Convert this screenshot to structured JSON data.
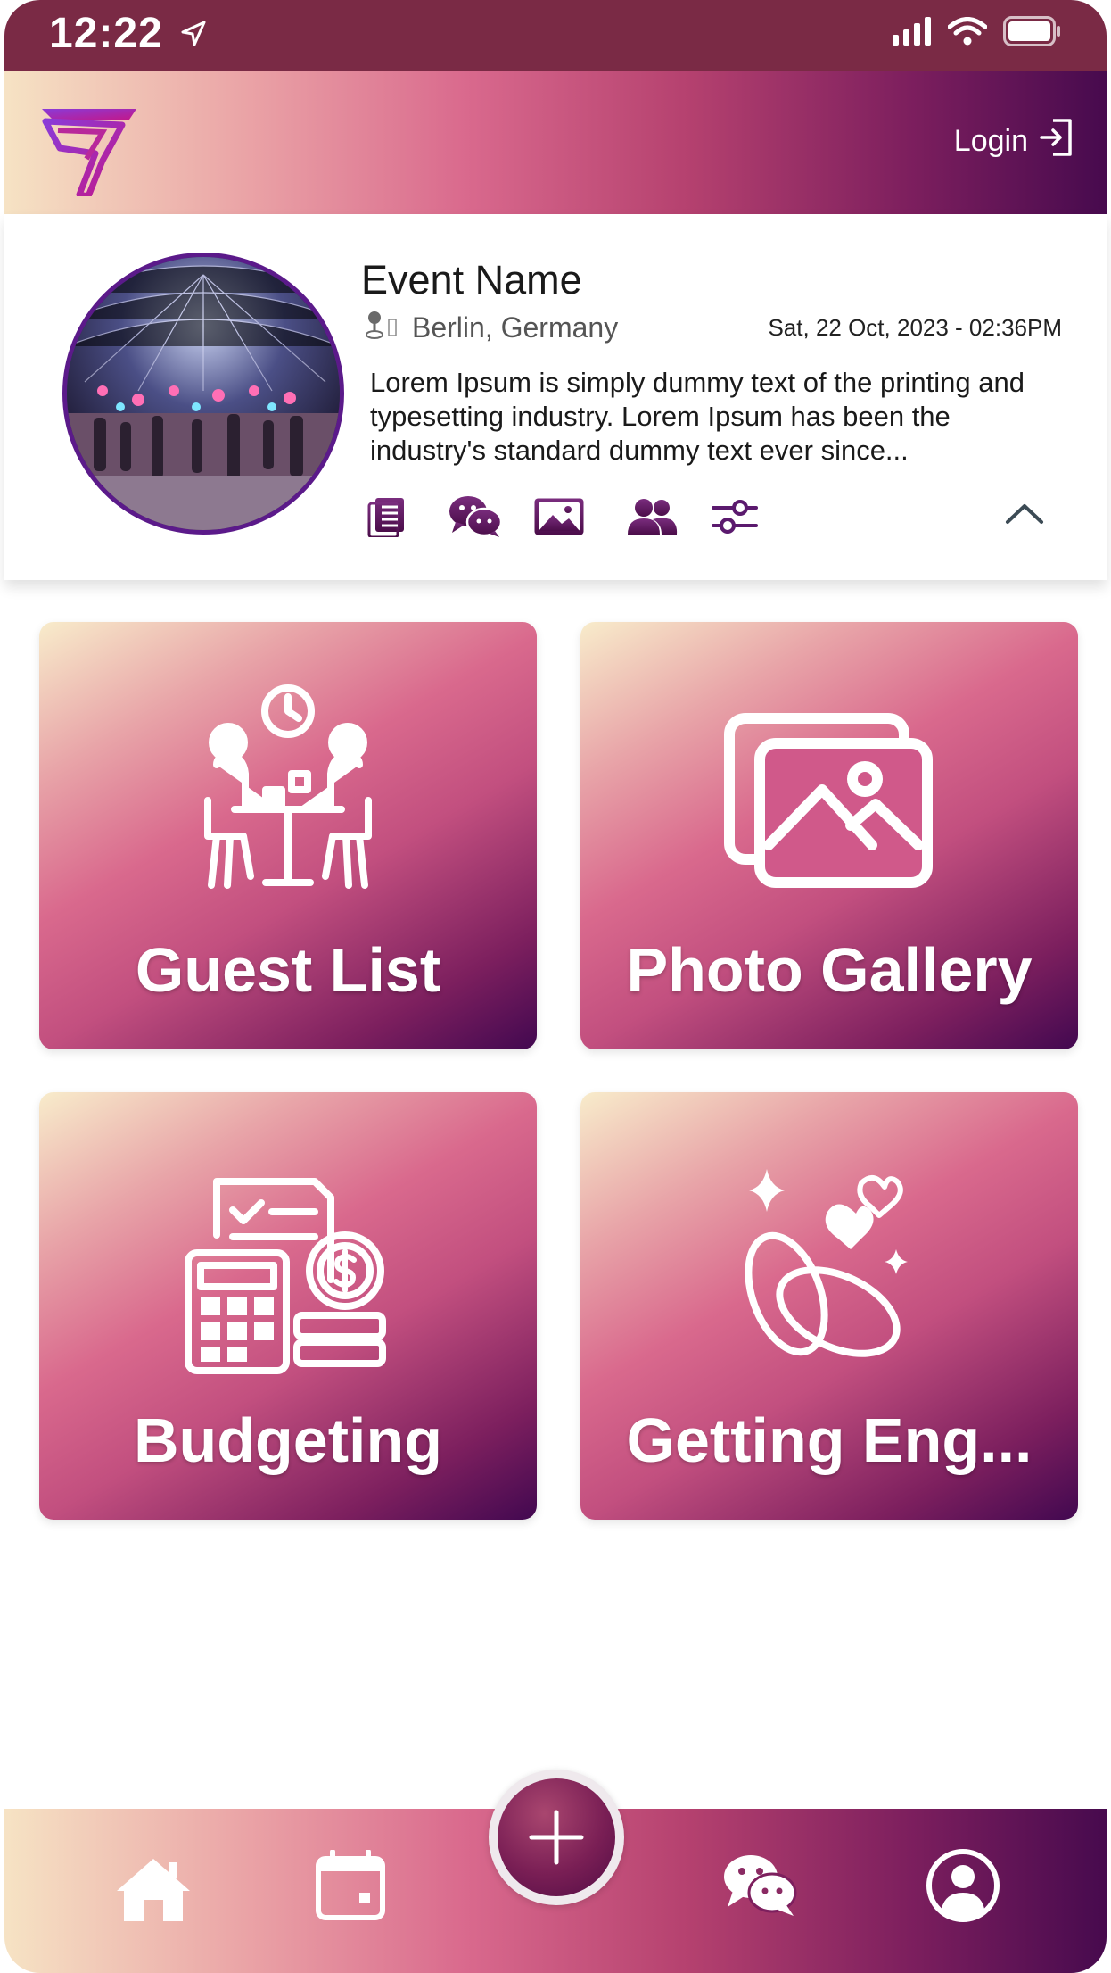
{
  "status_bar": {
    "time": "12:22"
  },
  "header": {
    "login_label": "Login"
  },
  "event": {
    "title": "Event Name",
    "location": "Berlin, Germany",
    "datetime": "Sat, 22 Oct, 2023 - 02:36PM",
    "description": "Lorem Ipsum is simply dummy text of the printing and typesetting industry. Lorem Ipsum has been the industry's standard dummy text ever since..."
  },
  "tiles": [
    {
      "label": "Guest List",
      "icon": "meeting-icon"
    },
    {
      "label": "Photo Gallery",
      "icon": "gallery-icon"
    },
    {
      "label": "Budgeting",
      "icon": "budget-icon"
    },
    {
      "label": "Getting Eng...",
      "icon": "rings-icon"
    }
  ],
  "event_actions": [
    "document-icon",
    "chat-icon",
    "image-icon",
    "group-icon",
    "settings-sliders-icon"
  ],
  "bottom_nav": [
    "home-icon",
    "calendar-icon",
    "add-icon",
    "chat-icon",
    "profile-icon"
  ],
  "colors": {
    "status_bar": "#7a2a45",
    "gradient_start": "#f6e3c4",
    "gradient_mid": "#d9698d",
    "gradient_end": "#470a4e",
    "icon_purple": "#5b1a6e"
  }
}
